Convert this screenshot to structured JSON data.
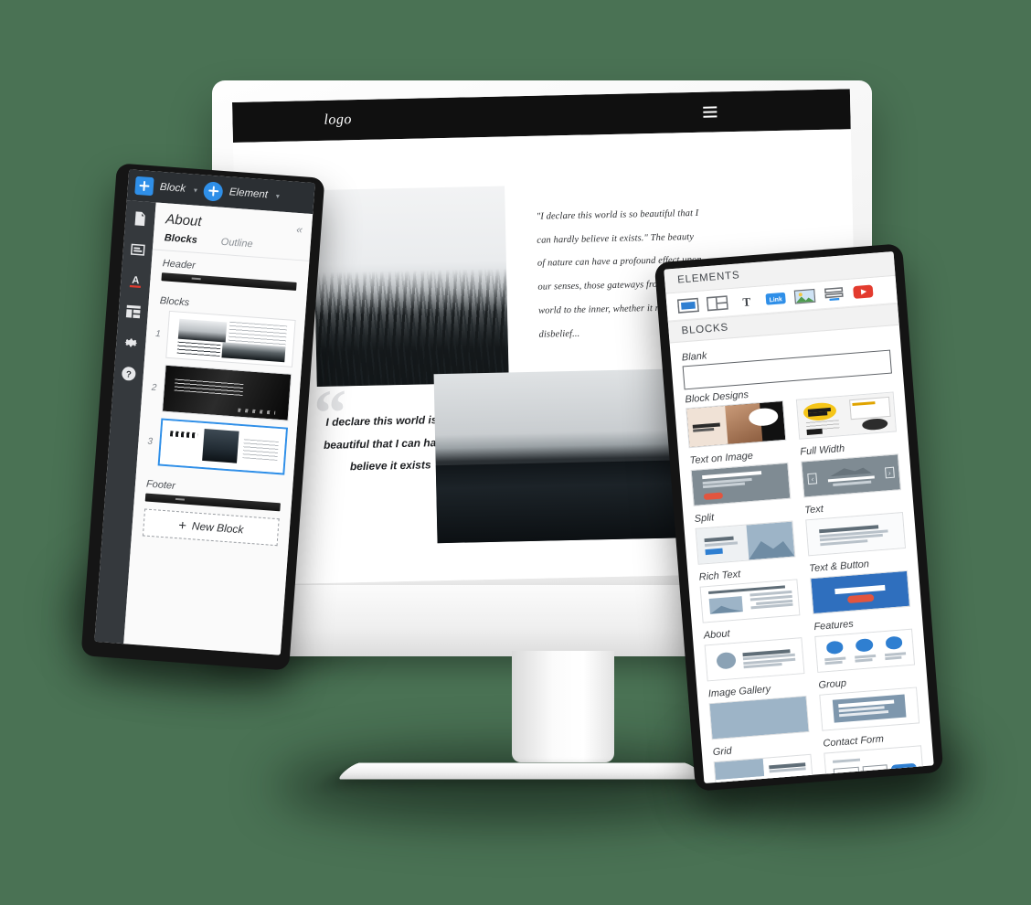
{
  "background_color": "#4a7254",
  "accent_color": "#2f8fe8",
  "desktop": {
    "site": {
      "logo": "logo",
      "menu_icon": "hamburger-icon",
      "quote_paragraph": "\"I declare this world is so beautiful that I can hardly believe it exists.\" The beauty of nature can have a profound effect upon our senses, those gateways from the outer world to the inner, whether it results in disbelief...",
      "pullquote_mark": "“",
      "pullquote": "I declare this world is so beautiful that I can hardly believe it exists",
      "images": {
        "forest": "misty-forest-photo",
        "mountain": "mountain-reflection-photo"
      }
    }
  },
  "tablet": {
    "toolbar": {
      "block_label": "Block",
      "element_label": "Element",
      "caret": "▾"
    },
    "rail_icons": [
      "page-icon",
      "block-icon",
      "font-color-icon",
      "layout-icon",
      "settings-gear-icon",
      "help-icon"
    ],
    "panel": {
      "title": "About",
      "collapse_label": "«",
      "tabs": [
        {
          "label": "Blocks",
          "active": true
        },
        {
          "label": "Outline",
          "active": false
        }
      ],
      "header_section": "Header",
      "blocks_section": "Blocks",
      "blocks": [
        {
          "num": "1",
          "selected": false
        },
        {
          "num": "2",
          "selected": false
        },
        {
          "num": "3",
          "selected": true
        }
      ],
      "footer_section": "Footer",
      "new_block_label": "New Block",
      "new_block_plus": "+"
    }
  },
  "phone": {
    "elements_header": "ELEMENTS",
    "element_icons": [
      "button-icon",
      "columns-icon",
      "text-icon",
      "link-icon",
      "image-icon",
      "form-icon",
      "youtube-icon"
    ],
    "blocks_header": "BLOCKS",
    "blank_label": "Blank",
    "block_designs_label": "Block Designs",
    "designs": [
      {
        "label": "Text on Image",
        "thumb": "beauty-salon-design"
      },
      {
        "label": "Full Width",
        "thumb": "design-studio-design"
      }
    ],
    "blocks": [
      {
        "label": "Text on Image",
        "thumb": "text-on-image-wireframe"
      },
      {
        "label": "Full Width",
        "thumb": "full-width-wireframe"
      },
      {
        "label": "Split",
        "thumb": "split-wireframe"
      },
      {
        "label": "Text",
        "thumb": "text-wireframe"
      },
      {
        "label": "Rich Text",
        "thumb": "rich-text-wireframe"
      },
      {
        "label": "Text & Button",
        "thumb": "text-button-wireframe"
      },
      {
        "label": "About",
        "thumb": "about-wireframe"
      },
      {
        "label": "Features",
        "thumb": "features-wireframe"
      },
      {
        "label": "Image Gallery",
        "thumb": "image-gallery-wireframe"
      },
      {
        "label": "Group",
        "thumb": "group-wireframe"
      },
      {
        "label": "Grid",
        "thumb": "grid-wireframe"
      },
      {
        "label": "Contact Form",
        "thumb": "contact-form-wireframe"
      }
    ]
  }
}
